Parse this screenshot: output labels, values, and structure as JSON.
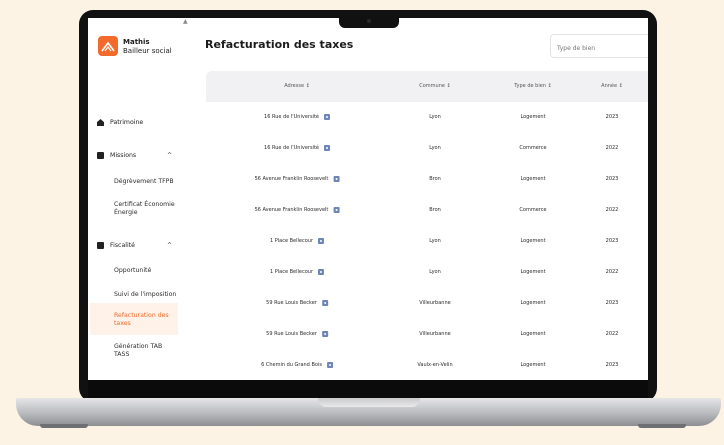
{
  "colors": {
    "background": "#fdf3e4",
    "accent": "#f26b2c"
  },
  "brand": {
    "name": "Mathis",
    "subtitle": "Bailleur social"
  },
  "sidebar": {
    "scroll_arrow": "▲",
    "sections": [
      {
        "label": "Patrimoine",
        "icon": "home-icon",
        "chevron": ""
      },
      {
        "label": "Missions",
        "icon": "clipboard-icon",
        "chevron": "^"
      },
      {
        "label": "Fiscalité",
        "icon": "document-icon",
        "chevron": "^"
      }
    ],
    "mission_items": [
      "Dégrèvement TFPB",
      "Certificat Économie",
      "Énergie"
    ],
    "fiscal_items": [
      "Opportunité",
      "Suivi de l'imposition",
      "Refacturation des",
      "taxes",
      "Génération TAB",
      "TASS"
    ]
  },
  "page": {
    "title": "Refacturation des taxes"
  },
  "search": {
    "placeholder": "Type de bien"
  },
  "table": {
    "columns": [
      "Adresse ↕",
      "Commune ↕",
      "Type de bien ↕",
      "Année ↕"
    ],
    "rows": [
      [
        "16 Rue de l'Université",
        "Lyon",
        "Logement",
        "2023"
      ],
      [
        "16 Rue de l'Université",
        "Lyon",
        "Commerce",
        "2022"
      ],
      [
        "56 Avenue Franklin Roosevelt",
        "Bron",
        "Logement",
        "2023"
      ],
      [
        "56 Avenue Franklin Roosevelt",
        "Bron",
        "Commerce",
        "2022"
      ],
      [
        "1 Place Bellecour",
        "Lyon",
        "Logement",
        "2023"
      ],
      [
        "1 Place Bellecour",
        "Lyon",
        "Logement",
        "2022"
      ],
      [
        "59 Rue Louis Becker",
        "Villeurbanne",
        "Logement",
        "2023"
      ],
      [
        "59 Rue Louis Becker",
        "Villeurbanne",
        "Logement",
        "2022"
      ],
      [
        "6 Chemin du Grand Bois",
        "Vaulx-en-Velin",
        "Logement",
        "2023"
      ]
    ]
  }
}
